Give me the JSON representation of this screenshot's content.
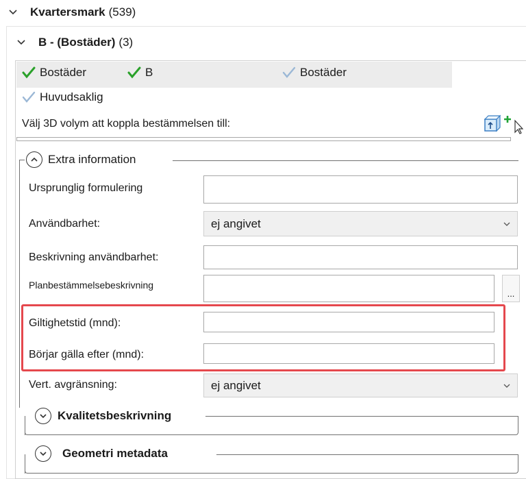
{
  "tree": {
    "kvartersmark": {
      "label": "Kvartersmark",
      "count": "(539)"
    },
    "bostader_group": {
      "label": "B - (Bostäder)",
      "count": "(3)"
    }
  },
  "tags": {
    "checked": [
      {
        "label": "Bostäder"
      },
      {
        "label": "B"
      }
    ],
    "unchecked": [
      {
        "label": "Bostäder"
      },
      {
        "label": "Huvudsaklig"
      }
    ],
    "active_color": "#2aa12a",
    "inactive_color": "#9bb8d6"
  },
  "volume": {
    "prompt": "Välj 3D volym att koppla bestämmelsen till:"
  },
  "extra": {
    "title": "Extra information",
    "fields": {
      "ursprunglig": {
        "label": "Ursprunglig formulering",
        "value": ""
      },
      "anvandbarhet": {
        "label": "Användbarhet:",
        "value": "ej angivet"
      },
      "beskrivning": {
        "label": "Beskrivning användbarhet:",
        "value": ""
      },
      "planbest": {
        "label": "Planbestämmelsebeskrivning",
        "value": "",
        "button": "..."
      },
      "giltighet": {
        "label": "Giltighetstid (mnd):",
        "value": ""
      },
      "borjar": {
        "label": "Börjar gälla efter (mnd):",
        "value": ""
      },
      "vert": {
        "label": "Vert. avgränsning:",
        "value": "ej angivet"
      }
    }
  },
  "kvalitet": {
    "title": "Kvalitetsbeskrivning"
  },
  "geometri": {
    "title": "Geometri metadata"
  },
  "highlight_color": "#e5484d"
}
